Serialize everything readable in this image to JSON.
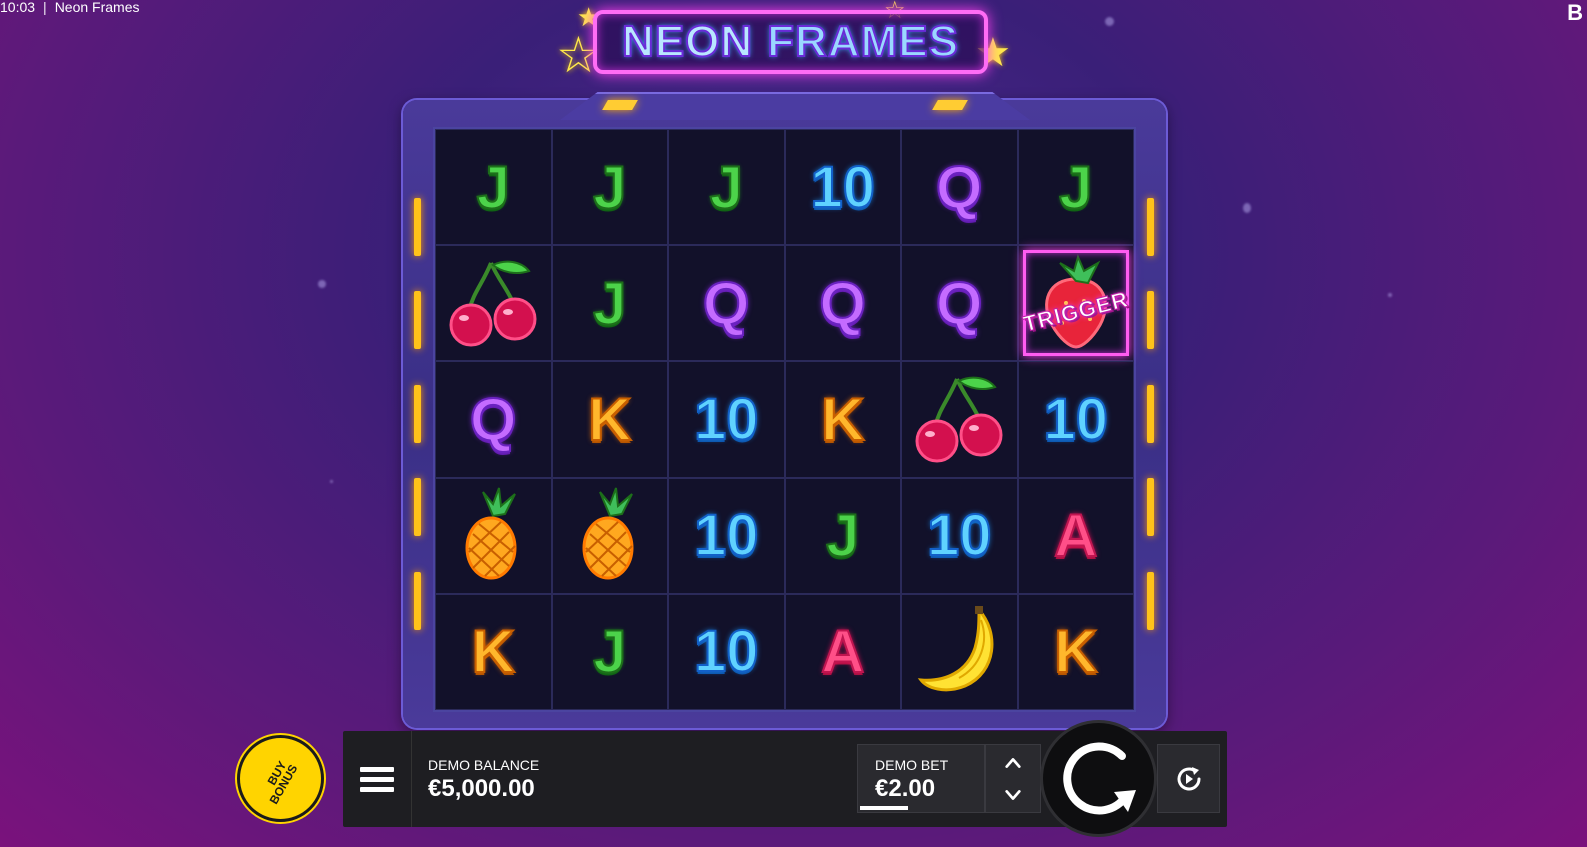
{
  "topbar": {
    "time": "10:03",
    "separator": "|",
    "title": "Neon Frames"
  },
  "brand_mark": "B",
  "logo": {
    "word1": "NEON",
    "word2": "FRAMES"
  },
  "grid": {
    "rows": [
      [
        {
          "sym": "J",
          "kind": "letter"
        },
        {
          "sym": "J",
          "kind": "letter"
        },
        {
          "sym": "J",
          "kind": "letter"
        },
        {
          "sym": "10",
          "kind": "letter"
        },
        {
          "sym": "Q",
          "kind": "letter"
        },
        {
          "sym": "J",
          "kind": "letter"
        }
      ],
      [
        {
          "sym": "cherry",
          "kind": "fruit"
        },
        {
          "sym": "J",
          "kind": "letter"
        },
        {
          "sym": "Q",
          "kind": "letter"
        },
        {
          "sym": "Q",
          "kind": "letter"
        },
        {
          "sym": "Q",
          "kind": "letter"
        },
        {
          "sym": "strawberry-trigger",
          "kind": "trigger"
        }
      ],
      [
        {
          "sym": "Q",
          "kind": "letter"
        },
        {
          "sym": "K",
          "kind": "letter"
        },
        {
          "sym": "10",
          "kind": "letter"
        },
        {
          "sym": "K",
          "kind": "letter"
        },
        {
          "sym": "cherry",
          "kind": "fruit"
        },
        {
          "sym": "10",
          "kind": "letter"
        }
      ],
      [
        {
          "sym": "pineapple",
          "kind": "fruit"
        },
        {
          "sym": "pineapple",
          "kind": "fruit"
        },
        {
          "sym": "10",
          "kind": "letter"
        },
        {
          "sym": "J",
          "kind": "letter"
        },
        {
          "sym": "10",
          "kind": "letter"
        },
        {
          "sym": "A",
          "kind": "letter"
        }
      ],
      [
        {
          "sym": "K",
          "kind": "letter"
        },
        {
          "sym": "J",
          "kind": "letter"
        },
        {
          "sym": "10",
          "kind": "letter"
        },
        {
          "sym": "A",
          "kind": "letter"
        },
        {
          "sym": "banana",
          "kind": "fruit"
        },
        {
          "sym": "K",
          "kind": "letter"
        }
      ]
    ],
    "trigger_label": "TRIGGER"
  },
  "controls": {
    "buy_bonus_line1": "BUY",
    "buy_bonus_line2": "BONUS",
    "balance_label": "DEMO BALANCE",
    "balance_value": "€5,000.00",
    "bet_label": "DEMO BET",
    "bet_value": "€2.00"
  },
  "icons": [
    "menu-icon",
    "chevron-up-icon",
    "chevron-down-icon",
    "spin-icon",
    "autoplay-icon"
  ]
}
